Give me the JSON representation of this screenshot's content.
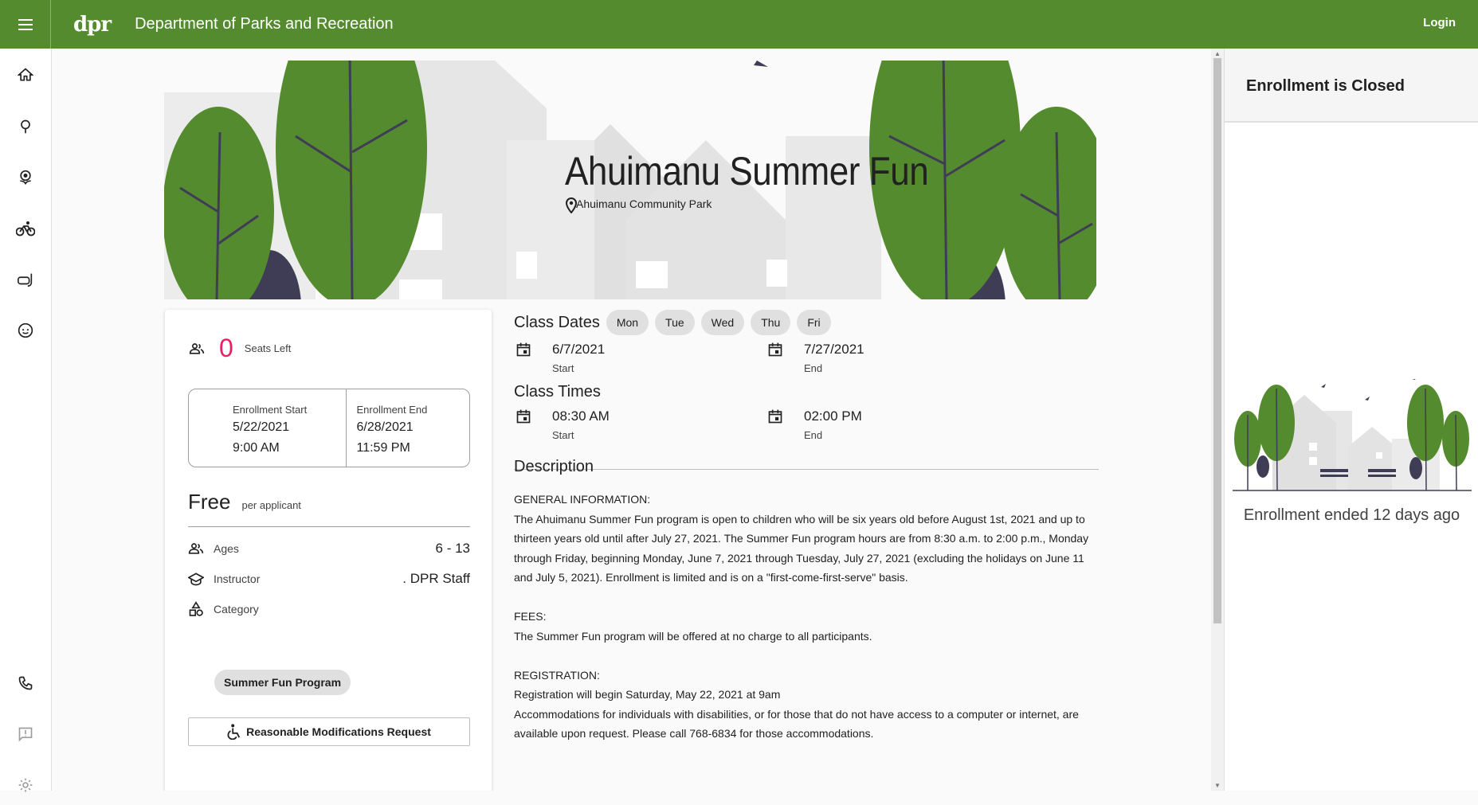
{
  "header": {
    "logo": "dpr",
    "title": "Department of Parks and Recreation",
    "login": "Login"
  },
  "rail": {
    "items": [
      "home-icon",
      "tree-icon",
      "flower-icon",
      "bike-icon",
      "snorkel-icon",
      "child-face-icon"
    ],
    "bottom": [
      "phone-icon",
      "feedback-icon",
      "settings-icon"
    ]
  },
  "hero": {
    "title": "Ahuimanu Summer Fun",
    "location": "Ahuimanu Community Park"
  },
  "card": {
    "seats_count": "0",
    "seats_label": "Seats Left",
    "enrollment_start_label": "Enrollment Start",
    "enrollment_start_date": "5/22/2021",
    "enrollment_start_time": "9:00 AM",
    "enrollment_end_label": "Enrollment End",
    "enrollment_end_date": "6/28/2021",
    "enrollment_end_time": "11:59 PM",
    "price": "Free",
    "price_unit": "per applicant",
    "ages_label": "Ages",
    "ages_value": "6 - 13",
    "instructor_label": "Instructor",
    "instructor_value": ". DPR Staff",
    "category_label": "Category",
    "category_value": "Summer Fun Program",
    "modifications_button": "Reasonable Modifications Request"
  },
  "details": {
    "class_dates_title": "Class Dates",
    "days": [
      "Mon",
      "Tue",
      "Wed",
      "Thu",
      "Fri"
    ],
    "start_date": "6/7/2021",
    "start_label": "Start",
    "end_date": "7/27/2021",
    "end_label": "End",
    "class_times_title": "Class Times",
    "start_time": "08:30 AM",
    "end_time": "02:00 PM",
    "description_title": "Description",
    "description_lines": [
      "GENERAL INFORMATION:",
      "The Ahuimanu Summer Fun program is open to children who will be six years old before August 1st, 2021 and up to thirteen years old until after July 27, 2021. The Summer Fun program hours are from 8:30 a.m. to 2:00 p.m., Monday through Friday, beginning Monday, June 7, 2021 through Tuesday, July 27, 2021 (excluding the holidays on June 11 and July 5, 2021). Enrollment is limited and is on a \"first-come-first-serve\" basis.",
      "",
      "FEES:",
      "The Summer Fun program will be offered at no charge to all participants.",
      "",
      "REGISTRATION:",
      "Registration will begin Saturday, May 22, 2021 at 9am",
      "Accommodations for individuals with disabilities, or for those that do not have access to a computer or internet, are available upon request. Please call 768-6834 for those accommodations."
    ]
  },
  "right_panel": {
    "title": "Enrollment is Closed",
    "message": "Enrollment ended 12 days ago"
  },
  "colors": {
    "brand": "#558b2f",
    "accent": "#e91e63",
    "tree_dark": "#3f3d56"
  }
}
